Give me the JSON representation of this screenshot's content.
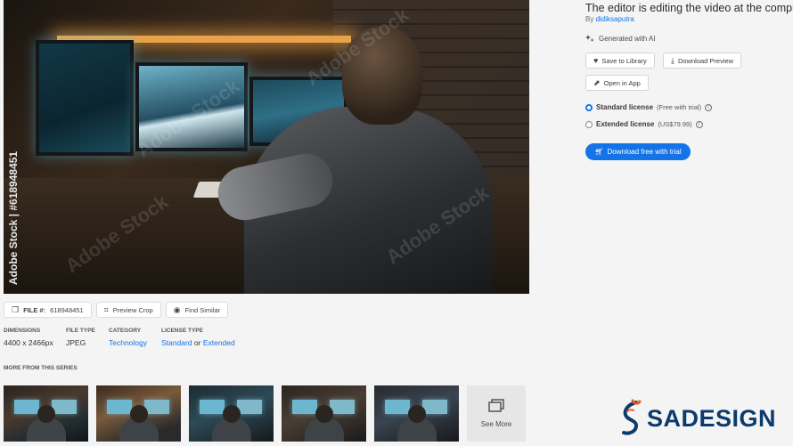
{
  "image": {
    "stock_id": "Adobe Stock | #618948451",
    "watermark": "Adobe Stock"
  },
  "asset": {
    "title": "The editor is editing the video at the computer",
    "by_prefix": "By",
    "author": "didiksaputra",
    "ai_label": "Generated with AI"
  },
  "actions": {
    "save": "Save to Library",
    "download_preview": "Download Preview",
    "open_in_app": "Open in App"
  },
  "licenses": {
    "standard": {
      "name": "Standard license",
      "note": "(Free with trial)"
    },
    "extended": {
      "name": "Extended license",
      "note": "(US$79.99)"
    }
  },
  "cta": {
    "label": "Download free with trial",
    "color": "#1473e6"
  },
  "chips": {
    "file_label": "FILE #:",
    "file_number": "618948451",
    "preview_crop": "Preview Crop",
    "find_similar": "Find Similar"
  },
  "meta": {
    "dimensions_label": "DIMENSIONS",
    "dimensions_value": "4400 x 2466px",
    "file_type_label": "FILE TYPE",
    "file_type_value": "JPEG",
    "category_label": "CATEGORY",
    "category_value": "Technology",
    "license_type_label": "LICENSE TYPE",
    "license_type_standard": "Standard",
    "license_type_or": "or",
    "license_type_extended": "Extended"
  },
  "series": {
    "heading": "MORE FROM THIS SERIES",
    "see_more": "See More"
  },
  "brand": {
    "name": "SADESIGN",
    "color": "#0b3b6d"
  }
}
